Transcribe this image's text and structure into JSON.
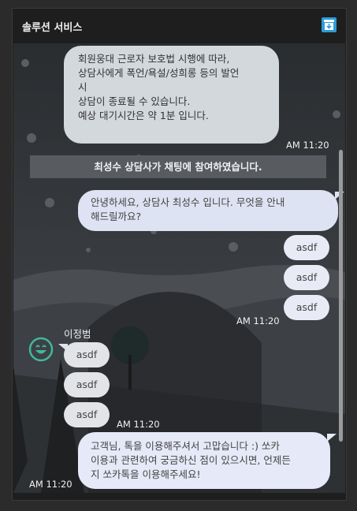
{
  "window": {
    "title": "솔루션 서비스"
  },
  "icons": {
    "archive": "archive-download-icon",
    "avatar": "smiley-avatar-icon"
  },
  "colors": {
    "accent": "#2d9cdb",
    "avatar": "#3fb99a"
  },
  "messages": {
    "notice": {
      "lines": [
        "회원웅대 근로자 보호법 시행에 따라,",
        "상담사에게 폭언/욕설/성희롱 등의 발언",
        "시",
        "상담이 종료될 수 있습니다.",
        "예상 대기시간은 약 1분 입니다."
      ],
      "time": "AM 11:20"
    },
    "system": "최성수 상담사가 채팅에 참여하였습니다.",
    "agent_greeting": {
      "lines": [
        "안녕하세요,  상담사 최성수 입니다. 무엇을 안내",
        "해드릴까요?"
      ]
    },
    "mine": {
      "items": [
        "asdf",
        "asdf",
        "asdf"
      ],
      "time": "AM 11:20"
    },
    "other": {
      "sender": "이정범",
      "items": [
        "asdf",
        "asdf",
        "asdf"
      ],
      "time": "AM 11:20"
    },
    "final": {
      "lines": [
        "고객님, 톡을 이용해주셔서 고맙습니다 :)  쏘카",
        "이용과 관련하여 궁금하신 점이 있으시면, 언제든",
        "지 쏘카톡을 이용해주세요!"
      ],
      "time": "AM 11:20"
    }
  }
}
